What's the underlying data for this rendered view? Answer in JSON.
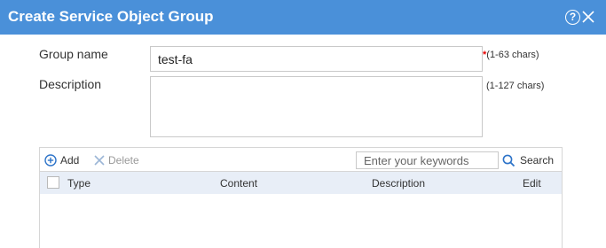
{
  "dialog": {
    "title": "Create Service Object Group",
    "help_label": "?"
  },
  "form": {
    "group_name_label": "Group name",
    "group_name_value": "test-fa",
    "group_name_required_mark": "*",
    "group_name_hint": "(1-63 chars)",
    "description_label": "Description",
    "description_value": "",
    "description_hint": "(1-127 chars)"
  },
  "toolbar": {
    "add_label": "Add",
    "delete_label": "Delete",
    "search_placeholder": "Enter your keywords",
    "search_label": "Search"
  },
  "table": {
    "columns": [
      "Type",
      "Content",
      "Description",
      "Edit"
    ]
  },
  "colors": {
    "titlebar": "#4a90d9",
    "header_bg": "#e8eef7",
    "required": "#e60000"
  }
}
